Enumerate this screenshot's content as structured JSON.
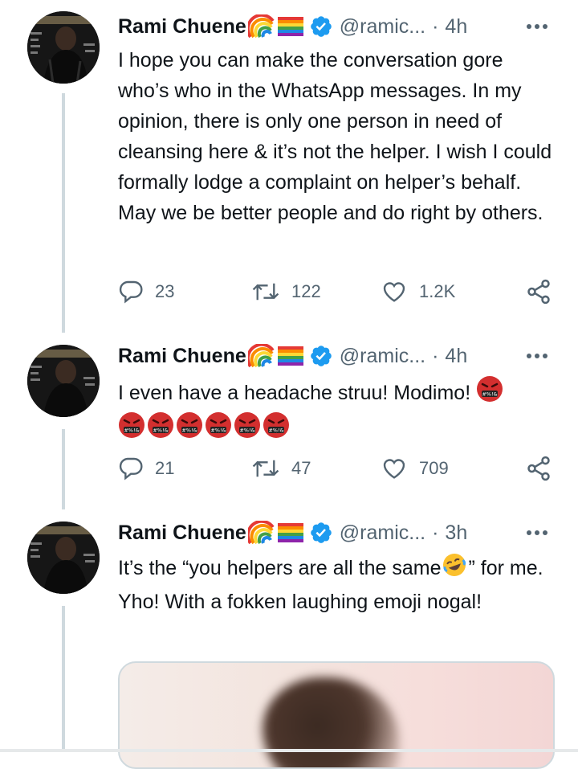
{
  "tweets": [
    {
      "name": "Rami Chuene",
      "handle": "@ramic...",
      "separator": "·",
      "time": "4h",
      "text": "I hope you can make the conversation gore who’s who in the WhatsApp messages. In my opinion, there is only one person in need of cleansing here & it’s not the helper. I wish I could formally lodge a complaint on helper’s behalf. May we be better people and do right by others.",
      "replies": "23",
      "retweets": "122",
      "likes": "1.2K"
    },
    {
      "name": "Rami Chuene",
      "handle": "@ramic...",
      "separator": "·",
      "time": "4h",
      "text": "I even have a headache struu! Modimo!",
      "emoji_label": "#%!&",
      "replies": "21",
      "retweets": "47",
      "likes": "709"
    },
    {
      "name": "Rami Chuene",
      "handle": "@ramic...",
      "separator": "·",
      "time": "3h",
      "text_part1": "It’s the “you helpers are all the same",
      "text_part2": "” for me. Yho! With a fokken laughing emoji nogal!"
    }
  ],
  "colors": {
    "verified": "#1d9bf0",
    "muted": "#536471",
    "line": "#cfd9de"
  },
  "icons": [
    "reply-icon",
    "retweet-icon",
    "like-icon",
    "share-icon",
    "more-icon",
    "verified-icon",
    "rainbow-flag-icon",
    "rainbow-flag-emoji",
    "angry-face-emoji",
    "laughing-emoji"
  ]
}
